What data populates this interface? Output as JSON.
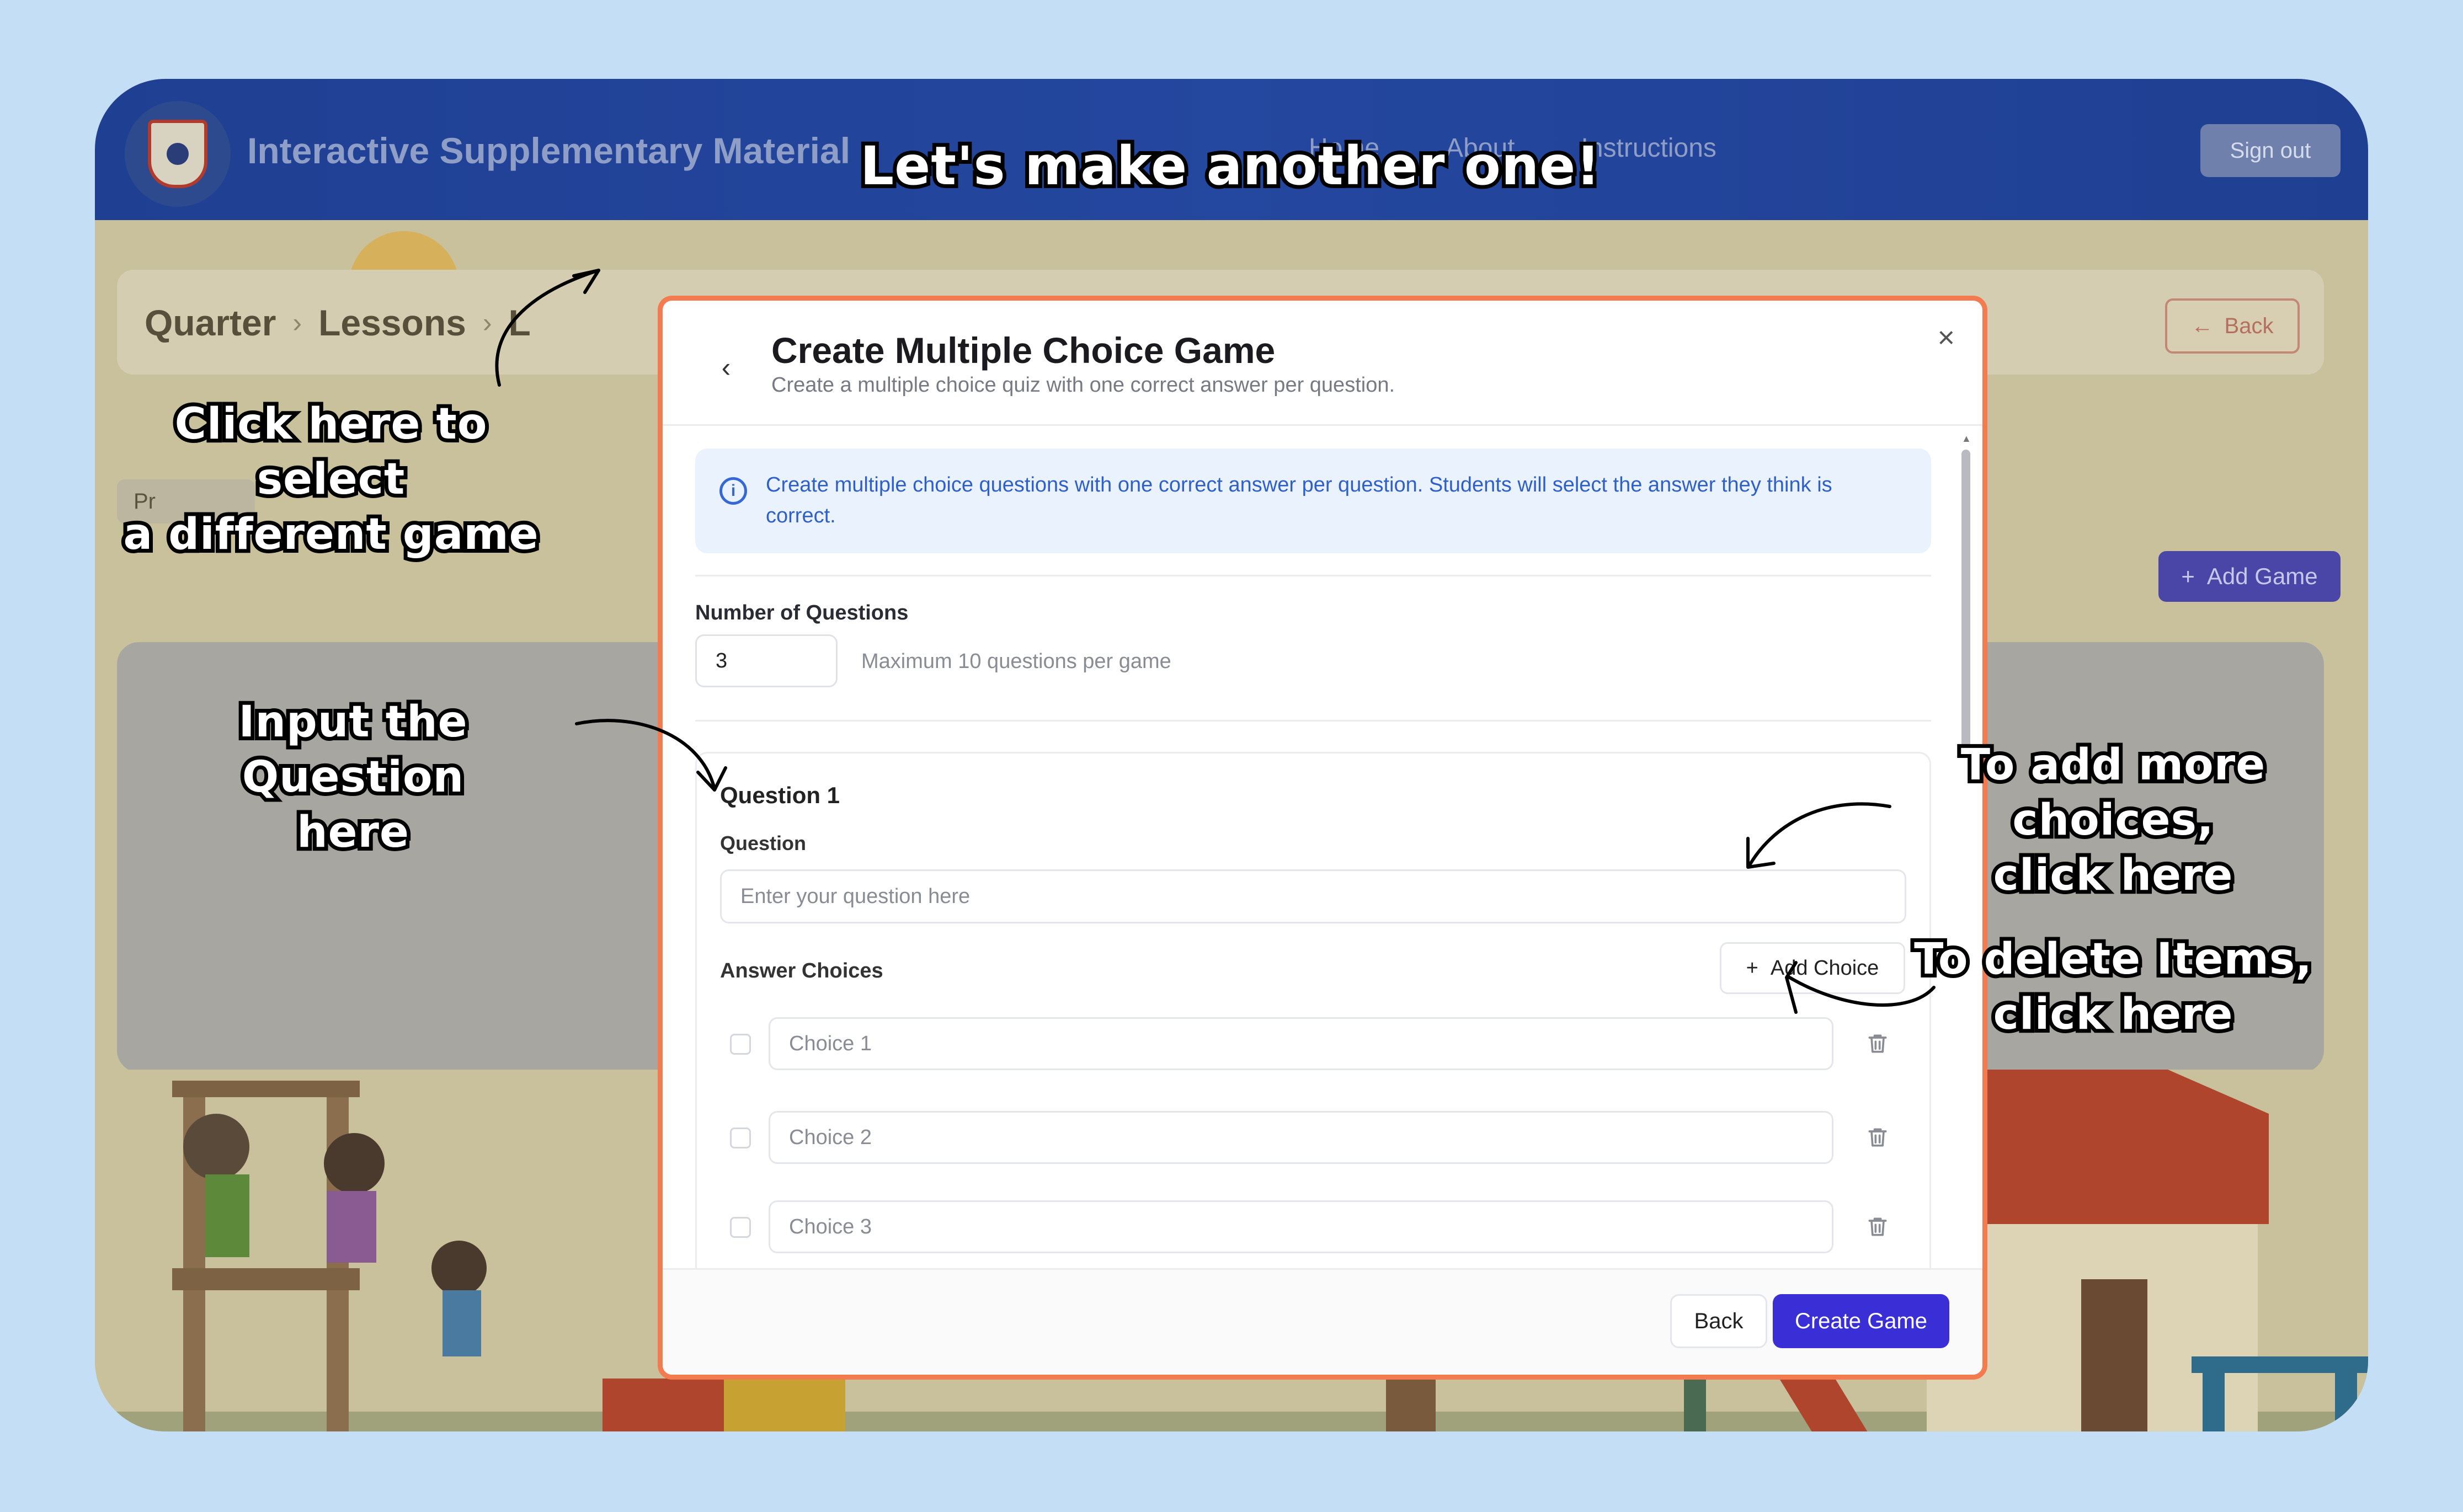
{
  "app": {
    "title": "Interactive Supplementary Material",
    "nav": [
      "Home",
      "About",
      "Instructions"
    ],
    "sign_out": "Sign out"
  },
  "page": {
    "breadcrumb": [
      "Quarter",
      "Lessons",
      "L"
    ],
    "back": "Back",
    "tab": "Pr",
    "add_game": "Add Game"
  },
  "modal": {
    "title": "Create Multiple Choice Game",
    "subtitle": "Create a multiple choice quiz with one correct answer per question.",
    "info": "Create multiple choice questions with one correct answer per question. Students will select the answer they think is correct.",
    "num_questions_label": "Number of Questions",
    "num_questions_value": "3",
    "num_questions_hint": "Maximum 10 questions per game",
    "question_title": "Question 1",
    "question_label": "Question",
    "question_placeholder": "Enter your question here",
    "answer_choices_label": "Answer Choices",
    "add_choice": "Add Choice",
    "choices": [
      "Choice 1",
      "Choice 2",
      "Choice 3"
    ],
    "back_button": "Back",
    "create_button": "Create Game"
  },
  "annotations": {
    "headline": "Let's make another one!",
    "select_game": [
      "Click here to select",
      "a different game"
    ],
    "input_question": [
      "Input the Question",
      "here"
    ],
    "add_choices": [
      "To add more choices,",
      "click here"
    ],
    "delete_items": [
      "To delete Items,",
      "click here"
    ]
  },
  "colors": {
    "page_bg": "#c4dff5",
    "navbar": "#24479f",
    "modal_border": "#f47a4f",
    "primary_button": "#3a2ed6",
    "info_text": "#2f5fc9"
  }
}
